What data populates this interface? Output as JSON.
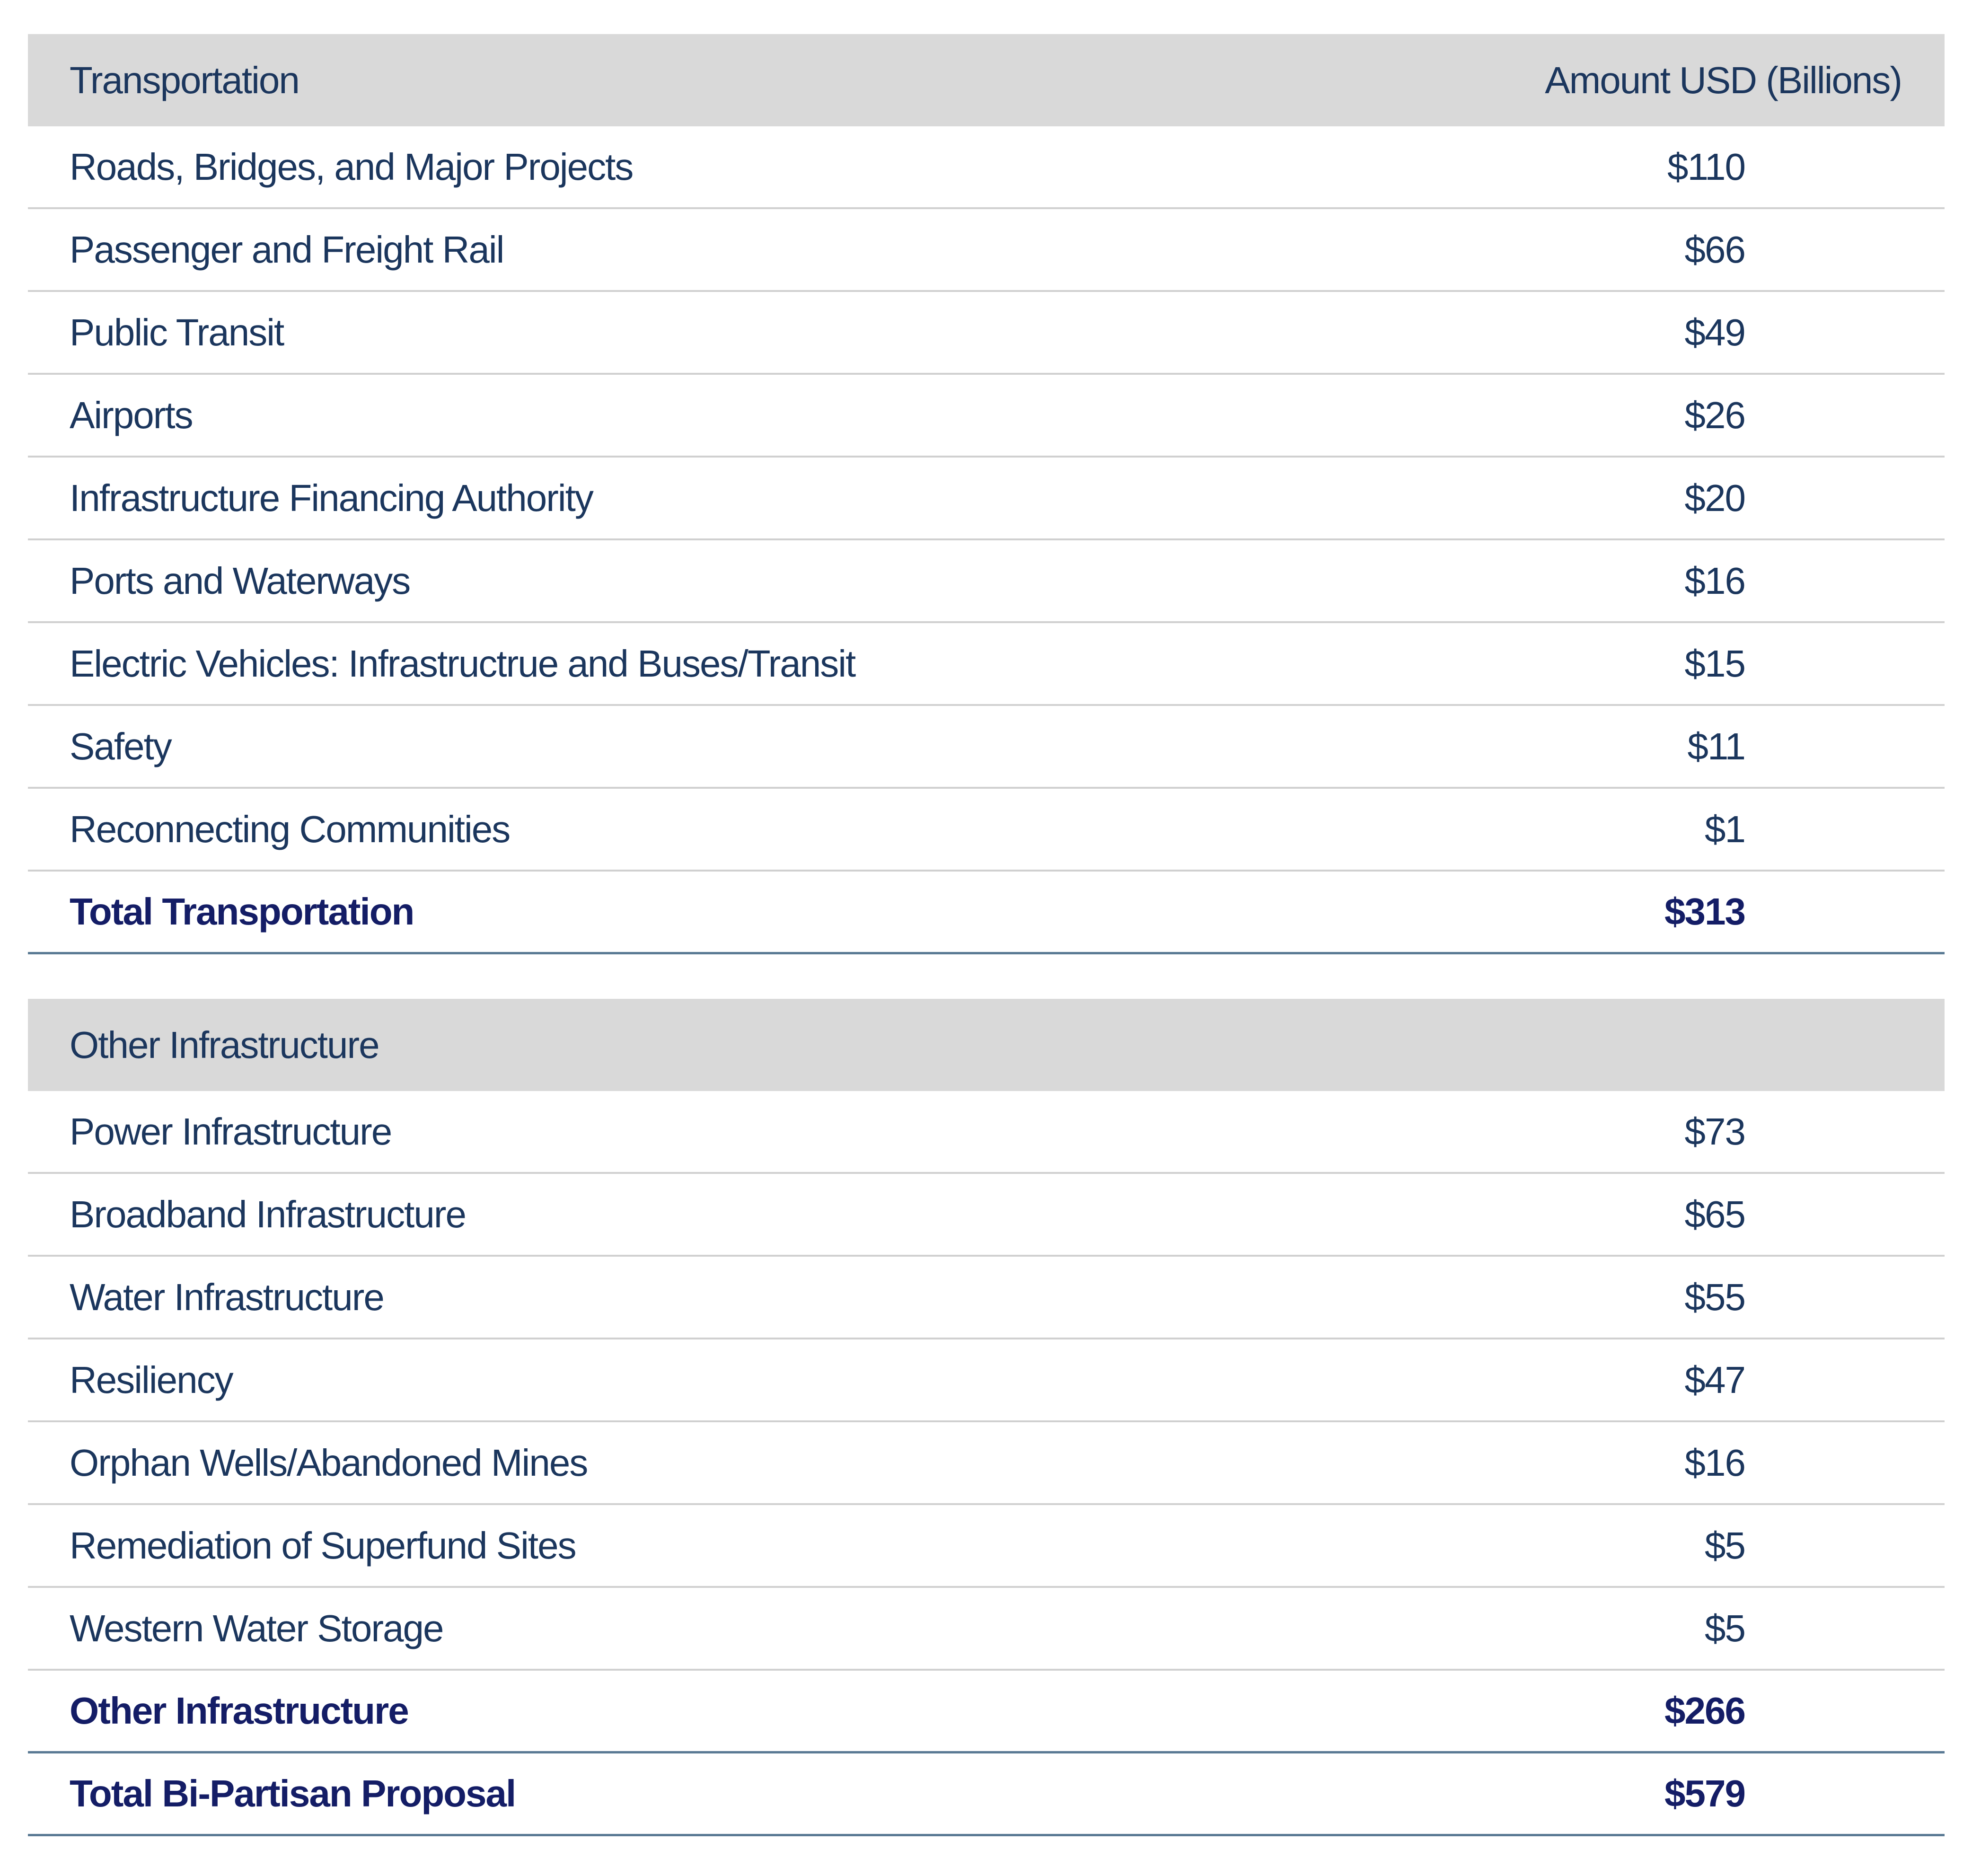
{
  "sections": [
    {
      "header": "Transportation",
      "amount_header": "Amount USD (Billions)",
      "rows": [
        {
          "label": "Roads, Bridges, and Major Projects",
          "value": "$110"
        },
        {
          "label": "Passenger and Freight Rail",
          "value": "$66"
        },
        {
          "label": "Public Transit",
          "value": "$49"
        },
        {
          "label": "Airports",
          "value": "$26"
        },
        {
          "label": "Infrastructure Financing Authority",
          "value": "$20"
        },
        {
          "label": "Ports and Waterways",
          "value": "$16"
        },
        {
          "label": "Electric Vehicles: Infrastructrue and Buses/Transit",
          "value": "$15"
        },
        {
          "label": "Safety",
          "value": "$11"
        },
        {
          "label": "Reconnecting Communities",
          "value": "$1"
        }
      ],
      "total": {
        "label": "Total Transportation",
        "value": "$313"
      }
    },
    {
      "header": "Other Infrastructure",
      "amount_header": "",
      "rows": [
        {
          "label": "Power Infrastructure",
          "value": "$73"
        },
        {
          "label": "Broadband Infrastructure",
          "value": "$65"
        },
        {
          "label": "Water Infrastructure",
          "value": "$55"
        },
        {
          "label": "Resiliency",
          "value": "$47"
        },
        {
          "label": "Orphan Wells/Abandoned Mines",
          "value": "$16"
        },
        {
          "label": "Remediation of Superfund Sites",
          "value": "$5"
        },
        {
          "label": "Western Water Storage",
          "value": "$5"
        }
      ],
      "total": {
        "label": "Other Infrastructure",
        "value": "$266"
      }
    }
  ],
  "grand_total": {
    "label": "Total Bi-Partisan Proposal",
    "value": "$579"
  },
  "colors": {
    "text": "#1b365d",
    "total_text": "#141d66",
    "header_bg": "#d9d9d9",
    "rule": "#5a7a94",
    "divider": "#d0d0d0"
  }
}
